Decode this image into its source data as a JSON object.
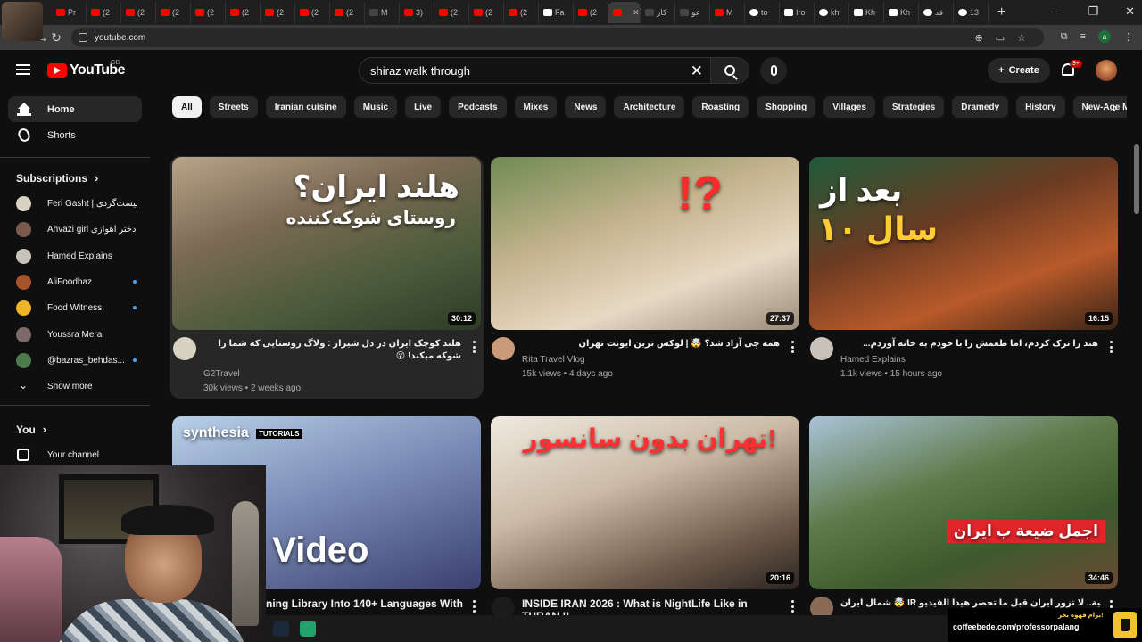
{
  "browser": {
    "tabs": [
      {
        "label": "Pr",
        "kind": "yt"
      },
      {
        "label": "(2",
        "kind": "yt"
      },
      {
        "label": "(2",
        "kind": "yt"
      },
      {
        "label": "(2",
        "kind": "yt"
      },
      {
        "label": "(2",
        "kind": "yt"
      },
      {
        "label": "(2",
        "kind": "yt"
      },
      {
        "label": "(2",
        "kind": "yt"
      },
      {
        "label": "(2",
        "kind": "yt"
      },
      {
        "label": "(2",
        "kind": "yt"
      },
      {
        "label": "M",
        "kind": "dark"
      },
      {
        "label": "3)",
        "kind": "yt"
      },
      {
        "label": "(2",
        "kind": "yt"
      },
      {
        "label": "(2",
        "kind": "yt"
      },
      {
        "label": "(2",
        "kind": "yt"
      },
      {
        "label": "Fa",
        "kind": "w"
      },
      {
        "label": "(2",
        "kind": "yt"
      },
      {
        "label": "",
        "kind": "yt",
        "active": true
      },
      {
        "label": "کار",
        "kind": "dark"
      },
      {
        "label": "عو",
        "kind": "dark"
      },
      {
        "label": "M",
        "kind": "yt"
      },
      {
        "label": "to",
        "kind": "g"
      },
      {
        "label": "Iro",
        "kind": "w"
      },
      {
        "label": "kh",
        "kind": "g"
      },
      {
        "label": "Kh",
        "kind": "w"
      },
      {
        "label": "Kh",
        "kind": "w"
      },
      {
        "label": "قد",
        "kind": "g"
      },
      {
        "label": "13",
        "kind": "g"
      }
    ],
    "url": "youtube.com",
    "account_initial": "a"
  },
  "header": {
    "logo_text": "YouTube",
    "country": "GB",
    "search_value": "shiraz walk through",
    "create_label": "Create",
    "notifications": "9+"
  },
  "sidebar": {
    "home": "Home",
    "shorts": "Shorts",
    "subscriptions_heading": "Subscriptions",
    "subscriptions": [
      {
        "name": "Feri Gasht | بیست‌گردی",
        "color": "#d8d2c4",
        "live": false
      },
      {
        "name": "Ahvazi girl دختر اهوازی",
        "color": "#7b5a4e",
        "live": false
      },
      {
        "name": "Hamed Explains",
        "color": "#c8c2b8",
        "live": false
      },
      {
        "name": "AliFoodbaz",
        "color": "#a5532b",
        "live": true
      },
      {
        "name": "Food Witness",
        "color": "#f0b429",
        "live": true
      },
      {
        "name": "Youssra Mera",
        "color": "#7d6a6a",
        "live": false
      },
      {
        "name": "@bazras_behdas...",
        "color": "#4d7a4a",
        "live": true
      }
    ],
    "show_more": "Show more",
    "you_heading": "You",
    "your_channel": "Your channel"
  },
  "chips": [
    "All",
    "Streets",
    "Iranian cuisine",
    "Music",
    "Live",
    "Podcasts",
    "Mixes",
    "News",
    "Architecture",
    "Roasting",
    "Shopping",
    "Villages",
    "Strategies",
    "Dramedy",
    "History",
    "New-Age Music"
  ],
  "videos": [
    {
      "thumb_text": "هلند ایران؟",
      "thumb_sub": "روستای شوکه‌کننده",
      "duration": "30:12",
      "title": "هلند کوچک ایران در دل شیراز : ولاگ روستایی که شما را شوکه میکند! 😮",
      "channel": "G2Travel",
      "meta": "30k views • 2 weeks ago"
    },
    {
      "thumb_text": "!?",
      "thumb_sub": "",
      "duration": "27:37",
      "title": "همه چی آزاد شد؟ 🤯 | لوکس ترین ایونت تهران",
      "channel": "Rita Travel Vlog",
      "meta": "15k views • 4 days ago"
    },
    {
      "thumb_text": "بعد از",
      "thumb_sub": "۱۰ سال",
      "duration": "16:15",
      "title": "هند را ترک کردم، اما طعمش را با خودم به خانه آوردم...",
      "channel": "Hamed Explains",
      "meta": "1.1k views • 15 hours ago"
    },
    {
      "thumb_text": "slate Video",
      "thumb_sub": "synthesia",
      "badge": "TUTORIALS",
      "duration": "",
      "title": "ning Library Into 140+ Languages With",
      "channel": "",
      "meta": ""
    },
    {
      "thumb_text": "تهران بدون سانسور!",
      "thumb_sub": "",
      "duration": "20:16",
      "title": "INSIDE IRAN 2026 : What is NightLife Like in THRAN !!",
      "channel": "",
      "meta": ""
    },
    {
      "thumb_text": "اجمل ضيعة ب ايران",
      "thumb_sub": "",
      "duration": "34:46",
      "title": "شمال ايران 🤯 IR حلة منسية.. لا تزور ايران قبل ما تحضر هيدا الفيديو",
      "channel": "",
      "meta": ""
    }
  ],
  "overlay": {
    "coffee_top": "برام قهوه بخر!",
    "coffee_url": "coffeebede.com/professorpalang"
  }
}
